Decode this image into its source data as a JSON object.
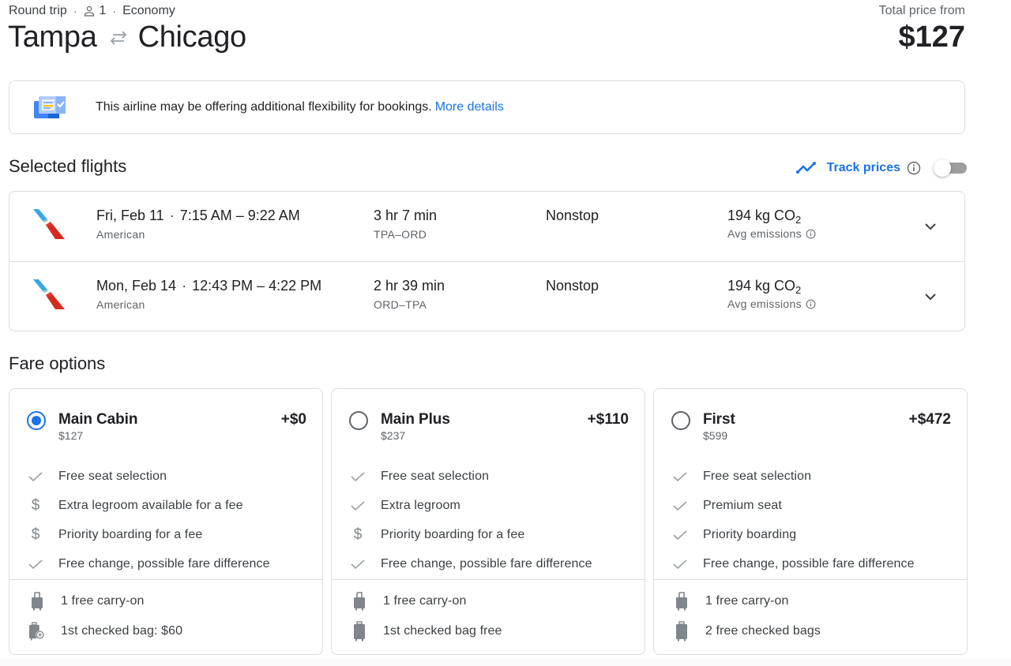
{
  "header": {
    "trip_type": "Round trip",
    "passengers": "1",
    "cabin": "Economy",
    "origin": "Tampa",
    "destination": "Chicago",
    "price_label": "Total price from",
    "price_total": "$127"
  },
  "banner": {
    "text": "This airline may be offering additional flexibility for bookings.",
    "link": "More details"
  },
  "selected_flights": {
    "title": "Selected flights",
    "track_prices_label": "Track prices",
    "track_prices_enabled": false,
    "flights": [
      {
        "date": "Fri, Feb 11",
        "times": "7:15 AM – 9:22 AM",
        "airline": "American",
        "duration": "3 hr 7 min",
        "route": "TPA–ORD",
        "stops": "Nonstop",
        "emissions_value": "194 kg CO",
        "emissions_sub": "2",
        "emissions_label": "Avg emissions"
      },
      {
        "date": "Mon, Feb 14",
        "times": "12:43 PM – 4:22 PM",
        "airline": "American",
        "duration": "2 hr 39 min",
        "route": "ORD–TPA",
        "stops": "Nonstop",
        "emissions_value": "194 kg CO",
        "emissions_sub": "2",
        "emissions_label": "Avg emissions"
      }
    ]
  },
  "fare_options": {
    "title": "Fare options",
    "fares": [
      {
        "name": "Main Cabin",
        "price": "$127",
        "delta": "+$0",
        "selected": true,
        "features": [
          {
            "icon": "check-icon",
            "text": "Free seat selection"
          },
          {
            "icon": "dollar-icon",
            "text": "Extra legroom available for a fee"
          },
          {
            "icon": "dollar-icon",
            "text": "Priority boarding for a fee"
          },
          {
            "icon": "check-icon",
            "text": "Free change, possible fare difference"
          }
        ],
        "bags": [
          {
            "icon": "carry-on-icon",
            "text": "1 free carry-on"
          },
          {
            "icon": "checked-bag-fee-icon",
            "text": "1st checked bag: $60"
          }
        ]
      },
      {
        "name": "Main Plus",
        "price": "$237",
        "delta": "+$110",
        "selected": false,
        "features": [
          {
            "icon": "check-icon",
            "text": "Free seat selection"
          },
          {
            "icon": "check-icon",
            "text": "Extra legroom"
          },
          {
            "icon": "dollar-icon",
            "text": "Priority boarding for a fee"
          },
          {
            "icon": "check-icon",
            "text": "Free change, possible fare difference"
          }
        ],
        "bags": [
          {
            "icon": "carry-on-icon",
            "text": "1 free carry-on"
          },
          {
            "icon": "checked-bag-icon",
            "text": "1st checked bag free"
          }
        ]
      },
      {
        "name": "First",
        "price": "$599",
        "delta": "+$472",
        "selected": false,
        "features": [
          {
            "icon": "check-icon",
            "text": "Free seat selection"
          },
          {
            "icon": "check-icon",
            "text": "Premium seat"
          },
          {
            "icon": "check-icon",
            "text": "Priority boarding"
          },
          {
            "icon": "check-icon",
            "text": "Free change, possible fare difference"
          }
        ],
        "bags": [
          {
            "icon": "carry-on-icon",
            "text": "1 free carry-on"
          },
          {
            "icon": "checked-bag-icon",
            "text": "2 free checked bags"
          }
        ]
      }
    ]
  },
  "colors": {
    "accent": "#1a73e8",
    "text_primary": "#202124",
    "text_secondary": "#5f6368",
    "border": "#dadce0",
    "icon_gray": "#80868b"
  }
}
